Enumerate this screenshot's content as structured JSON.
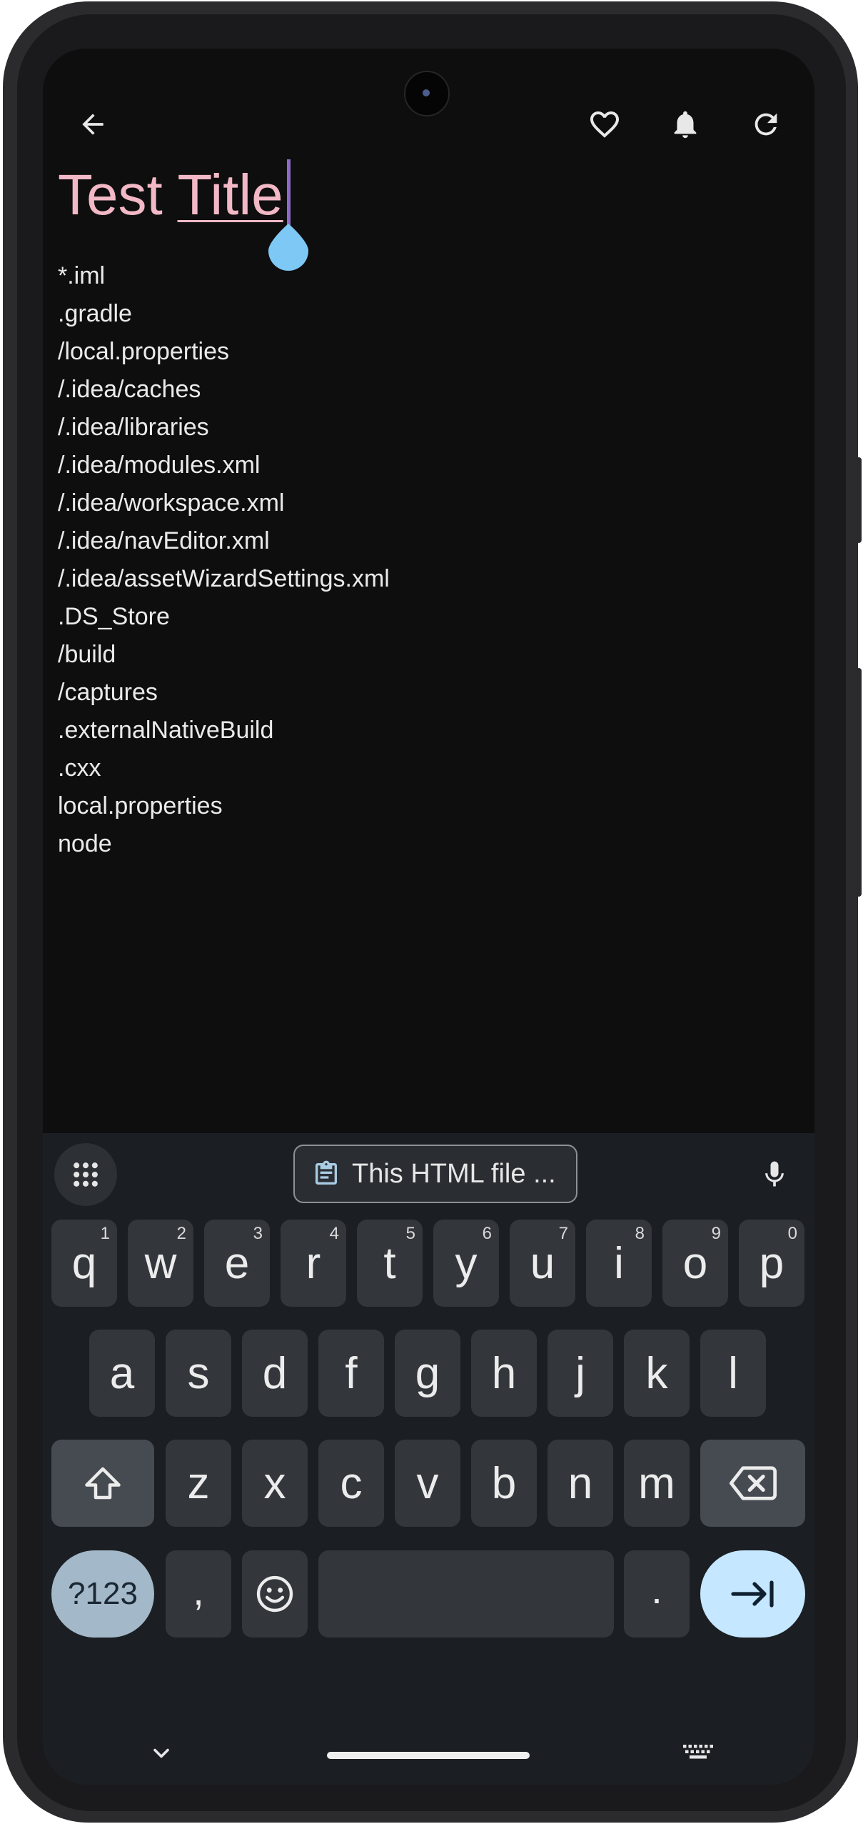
{
  "toolbar": {
    "back_icon": "arrow-left-icon",
    "favorite_icon": "heart-outline-icon",
    "reminder_icon": "bell-icon",
    "refresh_icon": "refresh-icon"
  },
  "note": {
    "title_word1": "Test",
    "title_word2": "Title",
    "title_color": "#f2b8c6",
    "body_lines": [
      "*.iml",
      ".gradle",
      "/local.properties",
      "/.idea/caches",
      "/.idea/libraries",
      "/.idea/modules.xml",
      "/.idea/workspace.xml",
      "/.idea/navEditor.xml",
      "/.idea/assetWizardSettings.xml",
      ".DS_Store",
      "/build",
      "/captures",
      ".externalNativeBuild",
      ".cxx",
      "local.properties",
      "node"
    ]
  },
  "keyboard": {
    "clipboard_suggestion": "This HTML file ...",
    "row1": [
      {
        "k": "q",
        "h": "1"
      },
      {
        "k": "w",
        "h": "2"
      },
      {
        "k": "e",
        "h": "3"
      },
      {
        "k": "r",
        "h": "4"
      },
      {
        "k": "t",
        "h": "5"
      },
      {
        "k": "y",
        "h": "6"
      },
      {
        "k": "u",
        "h": "7"
      },
      {
        "k": "i",
        "h": "8"
      },
      {
        "k": "o",
        "h": "9"
      },
      {
        "k": "p",
        "h": "0"
      }
    ],
    "row2": [
      "a",
      "s",
      "d",
      "f",
      "g",
      "h",
      "j",
      "k",
      "l"
    ],
    "row3": [
      "z",
      "x",
      "c",
      "v",
      "b",
      "n",
      "m"
    ],
    "symbols_label": "?123",
    "comma_label": ",",
    "period_label": ".",
    "accent_color": "#c5e7ff"
  }
}
